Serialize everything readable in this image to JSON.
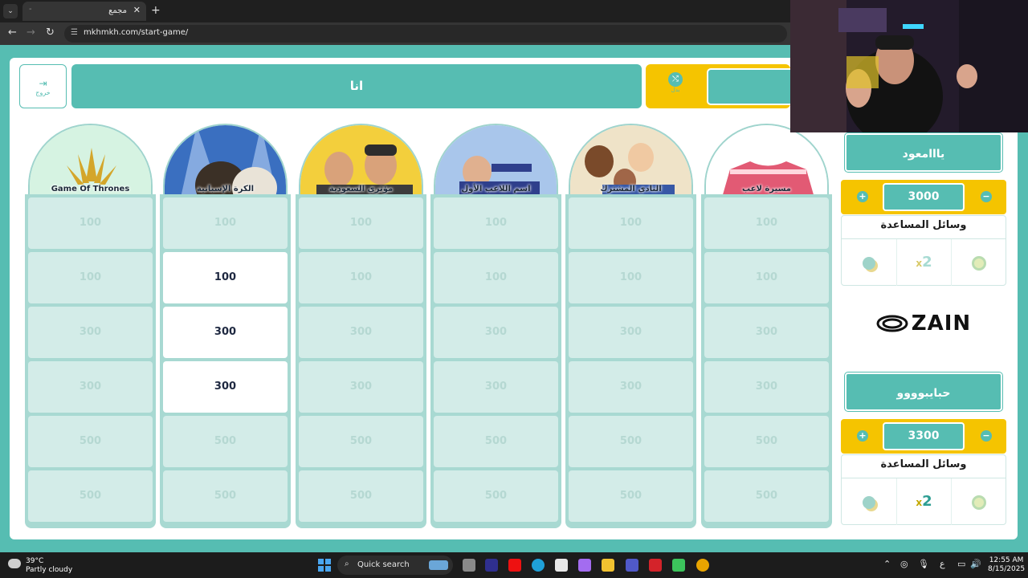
{
  "browser": {
    "tab_title": "مجمع",
    "tab_dash": "-",
    "tab_close": "✕",
    "new_tab": "+",
    "url": "mkhmkh.com/start-game/"
  },
  "header": {
    "exit_label": "خروج",
    "current_turn_team": "انا",
    "swap_label": "بدل"
  },
  "board": {
    "categories": [
      {
        "title": "Game Of Thrones"
      },
      {
        "title": "الكرة الإسبانية"
      },
      {
        "title": "مؤثري السعودية"
      },
      {
        "title": "اسم اللاعب الأول"
      },
      {
        "title": "النادي المشترك"
      },
      {
        "title": "مسيرة لاعب"
      }
    ],
    "rows": [
      "100",
      "100",
      "300",
      "300",
      "500",
      "500"
    ],
    "active_cells_column": 1,
    "active_rows": [
      1,
      2,
      3
    ]
  },
  "teams": [
    {
      "name": "يااامعود",
      "score": "3000",
      "aids_title": "وسائل المساعدة"
    },
    {
      "name": "حبايبوووو",
      "score": "3300",
      "aids_title": "وسائل المساعدة"
    }
  ],
  "aids": {
    "x2_label": "2",
    "x2_prefix": "x"
  },
  "sponsor": "ZAIN",
  "taskbar": {
    "temperature": "39°C",
    "weather": "Partly cloudy",
    "search_label": "Quick search",
    "time": "12:55 AM",
    "date": "8/15/2025",
    "lang": "ع"
  },
  "colors": {
    "primary_teal": "#56bdb2",
    "accent_yellow": "#f5c400",
    "cell_idle": "#d3ece8",
    "cell_active": "#ffffff"
  }
}
